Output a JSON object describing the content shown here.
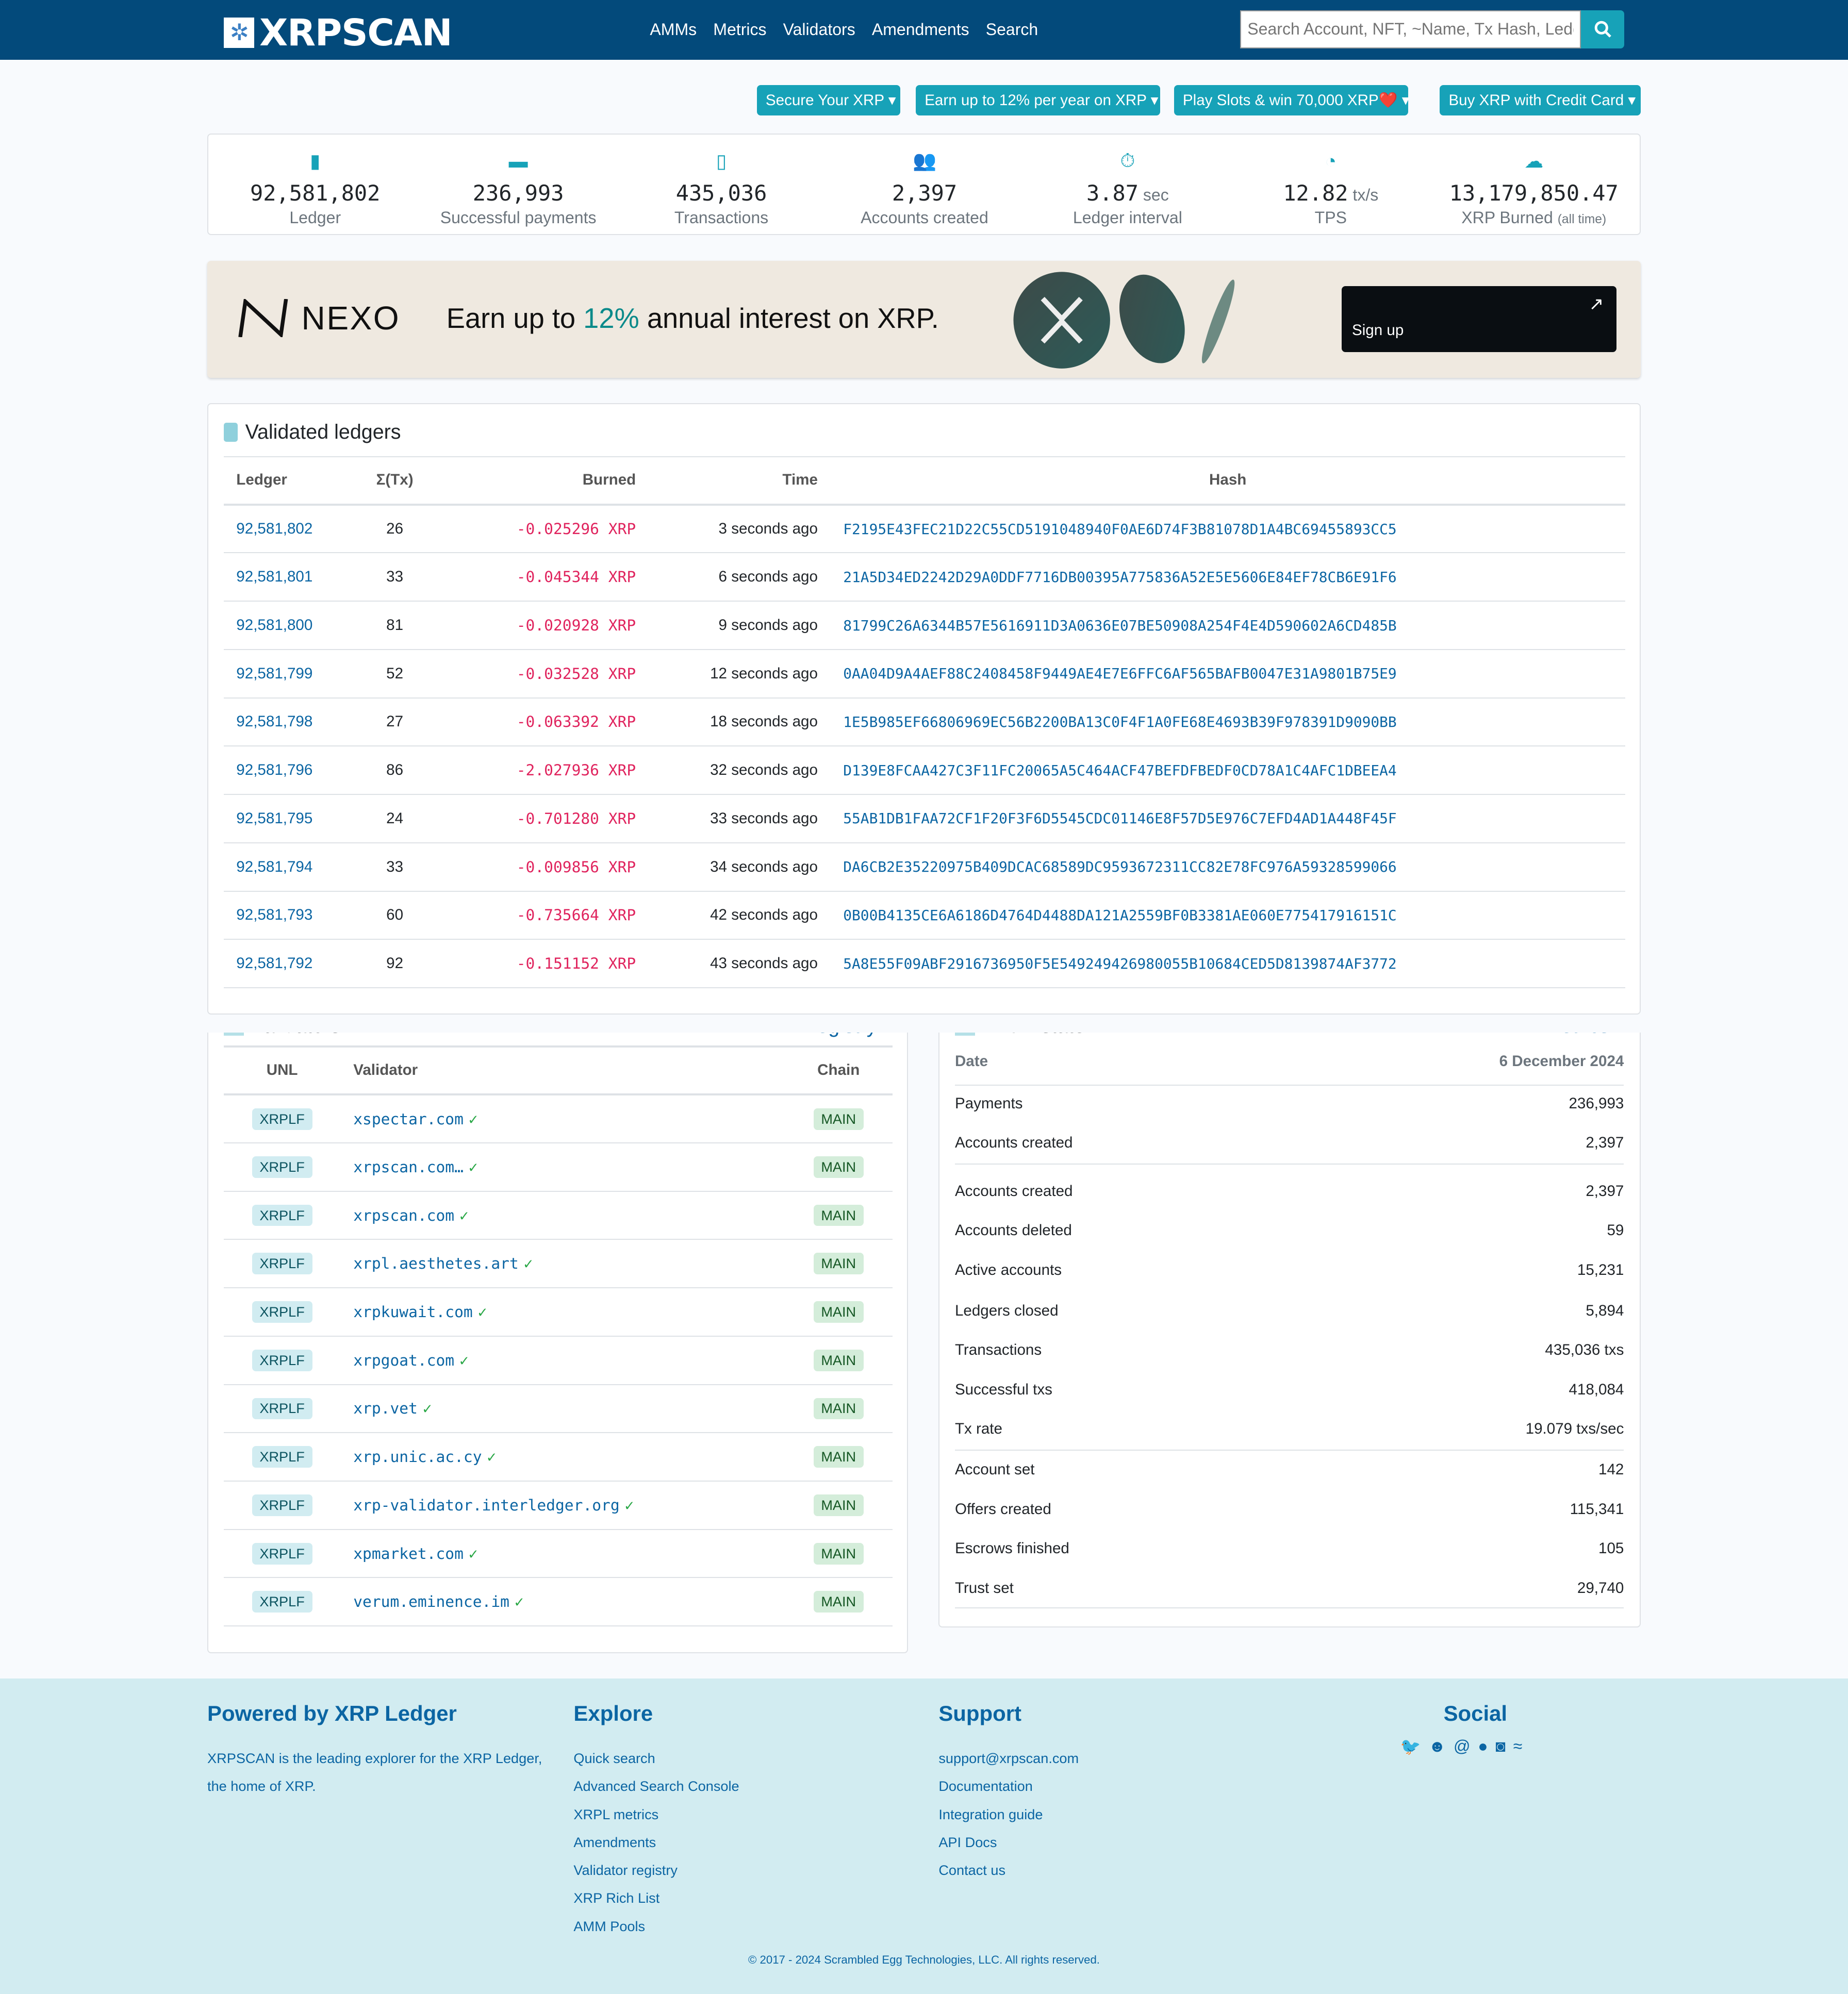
{
  "nav": {
    "logo": "XRPSCAN",
    "links": [
      "AMMs",
      "Metrics",
      "Validators",
      "Amendments",
      "Search"
    ],
    "search_placeholder": "Search Account, NFT, ~Name, Tx Hash, Ledger"
  },
  "ads": [
    "Secure Your XRP",
    "Earn up to 12% per year on XRP",
    "Play Slots & win 70,000 XRP❤️",
    "Buy XRP with Credit Card"
  ],
  "stats": [
    {
      "icon": "cube-icon",
      "value": "92,581,802",
      "unit": "",
      "label": "Ledger",
      "note": ""
    },
    {
      "icon": "credit-card-icon",
      "value": "236,993",
      "unit": "",
      "label": "Successful payments",
      "note": ""
    },
    {
      "icon": "file-icon",
      "value": "435,036",
      "unit": "",
      "label": "Transactions",
      "note": ""
    },
    {
      "icon": "users-icon",
      "value": "2,397",
      "unit": "",
      "label": "Accounts created",
      "note": ""
    },
    {
      "icon": "stopwatch-icon",
      "value": "3.87",
      "unit": " sec",
      "label": "Ledger interval",
      "note": ""
    },
    {
      "icon": "gauge-icon",
      "value": "12.82",
      "unit": " tx/s",
      "label": "TPS",
      "note": ""
    },
    {
      "icon": "fire-icon",
      "value": "13,179,850.47",
      "unit": "",
      "label": "XRP Burned",
      "note": "(all time)"
    }
  ],
  "banner": {
    "brand": "NEXO",
    "text_pre": "Earn up to ",
    "text_highlight": "12%",
    "text_post": " annual interest on XRP.",
    "cta": "Sign up"
  },
  "ledgers": {
    "title": "Validated ledgers",
    "columns": [
      "Ledger",
      "Σ(Tx)",
      "Burned",
      "Time",
      "Hash"
    ],
    "rows": [
      [
        "92,581,802",
        "26",
        "-0.025296 XRP",
        "3 seconds ago",
        "F2195E43FEC21D22C55CD5191048940F0AE6D74F3B81078D1A4BC69455893CC5"
      ],
      [
        "92,581,801",
        "33",
        "-0.045344 XRP",
        "6 seconds ago",
        "21A5D34ED2242D29A0DDF7716DB00395A775836A52E5E5606E84EF78CB6E91F6"
      ],
      [
        "92,581,800",
        "81",
        "-0.020928 XRP",
        "9 seconds ago",
        "81799C26A6344B57E5616911D3A0636E07BE50908A254F4E4D590602A6CD485B"
      ],
      [
        "92,581,799",
        "52",
        "-0.032528 XRP",
        "12 seconds ago",
        "0AA04D9A4AEF88C2408458F9449AE4E7E6FFC6AF565BAFB0047E31A9801B75E9"
      ],
      [
        "92,581,798",
        "27",
        "-0.063392 XRP",
        "18 seconds ago",
        "1E5B985EF66806969EC56B2200BA13C0F4F1A0FE68E4693B39F978391D9090BB"
      ],
      [
        "92,581,796",
        "86",
        "-2.027936 XRP",
        "32 seconds ago",
        "D139E8FCAA427C3F11FC20065A5C464ACF47BEFDFBEDF0CD78A1C4AFC1DBEEA4"
      ],
      [
        "92,581,795",
        "24",
        "-0.701280 XRP",
        "33 seconds ago",
        "55AB1DB1FAA72CF1F20F3F6D5545CDC01146E8F57D5E976C7EFD4AD1A448F45F"
      ],
      [
        "92,581,794",
        "33",
        "-0.009856 XRP",
        "34 seconds ago",
        "DA6CB2E35220975B409DCAC68589DC9593672311CC82E78FC976A59328599066"
      ],
      [
        "92,581,793",
        "60",
        "-0.735664 XRP",
        "42 seconds ago",
        "0B00B4135CE6A6186D4764D4488DA121A2559BF0B3381AE060E775417916151C"
      ],
      [
        "92,581,792",
        "92",
        "-0.151152 XRP",
        "43 seconds ago",
        "5A8E55F09ABF2916736950F5E549249426980055B10684CED5D8139874AF3772"
      ]
    ]
  },
  "validators": {
    "title": "Validators",
    "link": "Registry ›",
    "columns": [
      "UNL",
      "Validator",
      "Chain"
    ],
    "rows": [
      [
        "XRPLF",
        "xspectar.com",
        "MAIN"
      ],
      [
        "XRPLF",
        "xrpscan.com…",
        "MAIN"
      ],
      [
        "XRPLF",
        "xrpscan.com",
        "MAIN"
      ],
      [
        "XRPLF",
        "xrpl.aesthetes.art",
        "MAIN"
      ],
      [
        "XRPLF",
        "xrpkuwait.com",
        "MAIN"
      ],
      [
        "XRPLF",
        "xrpgoat.com",
        "MAIN"
      ],
      [
        "XRPLF",
        "xrp.vet",
        "MAIN"
      ],
      [
        "XRPLF",
        "xrp.unic.ac.cy",
        "MAIN"
      ],
      [
        "XRPLF",
        "xrp-validator.interledger.org",
        "MAIN"
      ],
      [
        "XRPLF",
        "xpmarket.com",
        "MAIN"
      ],
      [
        "XRPLF",
        "verum.eminence.im",
        "MAIN"
      ]
    ]
  },
  "state": {
    "title": "XRPL state",
    "link": "Metrics ›",
    "date_label": "Date",
    "date": "6 December 2024",
    "rows": [
      [
        "Payments",
        "236,993"
      ],
      [
        "Accounts created",
        "2,397"
      ],
      [
        "Accounts created",
        "2,397"
      ],
      [
        "Accounts deleted",
        "59"
      ],
      [
        "Active accounts",
        "15,231"
      ],
      [
        "Ledgers closed",
        "5,894"
      ],
      [
        "Transactions",
        "435,036 txs"
      ],
      [
        "Successful txs",
        "418,084"
      ],
      [
        "Tx rate",
        "19.079 txs/sec"
      ],
      [
        "Account set",
        "142"
      ],
      [
        "Offers created",
        "115,341"
      ],
      [
        "Escrows finished",
        "105"
      ],
      [
        "Trust set",
        "29,740"
      ]
    ]
  },
  "footer": {
    "powered_title": "Powered by XRP Ledger",
    "powered_text": "XRPSCAN is the leading explorer for the XRP Ledger, the home of XRP.",
    "explore_title": "Explore",
    "explore": [
      "Quick search",
      "Advanced Search Console",
      "XRPL metrics",
      "Amendments",
      "Validator registry",
      "XRP Rich List",
      "AMM Pools"
    ],
    "support_title": "Support",
    "support": [
      "support@xrpscan.com",
      "Documentation",
      "Integration guide",
      "API Docs",
      "Contact us"
    ],
    "social_title": "Social",
    "social_icons": [
      "twitter-icon",
      "reddit-icon",
      "threads-icon",
      "github-icon",
      "instagram-icon",
      "xrpl-icon"
    ],
    "copyright": "© 2017 - 2024 Scrambled Egg Technologies, LLC. All rights reserved."
  },
  "colors": {
    "navbar": "#034a7b",
    "accent": "#17a2b8",
    "link": "#0b65a3",
    "burned": "#e0245e",
    "footer_bg": "#d2ecf1"
  }
}
